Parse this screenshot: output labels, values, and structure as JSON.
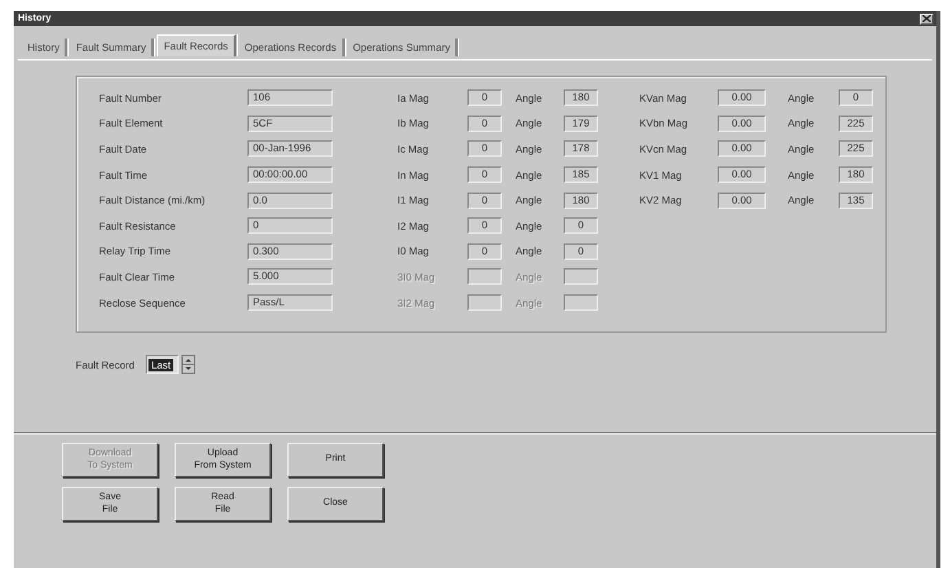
{
  "window": {
    "title": "History"
  },
  "tabs": [
    {
      "label": "History",
      "selected": false
    },
    {
      "label": "Fault Summary",
      "selected": false
    },
    {
      "label": "Fault Records",
      "selected": true
    },
    {
      "label": "Operations Records",
      "selected": false
    },
    {
      "label": "Operations Summary",
      "selected": false
    }
  ],
  "fault_info": [
    {
      "label": "Fault Number",
      "value": "106"
    },
    {
      "label": "Fault Element",
      "value": "5CF"
    },
    {
      "label": "Fault Date",
      "value": "00-Jan-1996"
    },
    {
      "label": "Fault Time",
      "value": "00:00:00.00"
    },
    {
      "label": "Fault Distance (mi./km)",
      "value": "0.0"
    },
    {
      "label": "Fault Resistance",
      "value": "0"
    },
    {
      "label": "Relay Trip Time",
      "value": "0.300"
    },
    {
      "label": "Fault Clear Time",
      "value": "5.000"
    },
    {
      "label": "Reclose Sequence",
      "value": "Pass/L"
    }
  ],
  "currents": [
    {
      "label": "Ia Mag",
      "mag": "0",
      "angle_label": "Angle",
      "angle": "180",
      "disabled": false
    },
    {
      "label": "Ib Mag",
      "mag": "0",
      "angle_label": "Angle",
      "angle": "179",
      "disabled": false
    },
    {
      "label": "Ic Mag",
      "mag": "0",
      "angle_label": "Angle",
      "angle": "178",
      "disabled": false
    },
    {
      "label": "In Mag",
      "mag": "0",
      "angle_label": "Angle",
      "angle": "185",
      "disabled": false
    },
    {
      "label": "I1 Mag",
      "mag": "0",
      "angle_label": "Angle",
      "angle": "180",
      "disabled": false
    },
    {
      "label": "I2 Mag",
      "mag": "0",
      "angle_label": "Angle",
      "angle": "0",
      "disabled": false
    },
    {
      "label": "I0 Mag",
      "mag": "0",
      "angle_label": "Angle",
      "angle": "0",
      "disabled": false
    },
    {
      "label": "3I0 Mag",
      "angle_label": "Angle",
      "disabled": true
    },
    {
      "label": "3I2 Mag",
      "angle_label": "Angle",
      "disabled": true
    }
  ],
  "voltages": [
    {
      "label": "KVan Mag",
      "mag": "0.00",
      "angle_label": "Angle",
      "angle": "0"
    },
    {
      "label": "KVbn Mag",
      "mag": "0.00",
      "angle_label": "Angle",
      "angle": "225"
    },
    {
      "label": "KVcn Mag",
      "mag": "0.00",
      "angle_label": "Angle",
      "angle": "225"
    },
    {
      "label": "KV1 Mag",
      "mag": "0.00",
      "angle_label": "Angle",
      "angle": "180"
    },
    {
      "label": "KV2 Mag",
      "mag": "0.00",
      "angle_label": "Angle",
      "angle": "135"
    }
  ],
  "fault_record": {
    "label": "Fault Record",
    "value": "Last"
  },
  "buttons": [
    {
      "lines": [
        "Download",
        "To System"
      ],
      "disabled": true
    },
    {
      "lines": [
        "Upload",
        "From System"
      ],
      "disabled": false
    },
    {
      "lines": [
        "Print"
      ],
      "disabled": false
    },
    {
      "lines": [
        "Save",
        "File"
      ],
      "disabled": false
    },
    {
      "lines": [
        "Read",
        "File"
      ],
      "disabled": false
    },
    {
      "lines": [
        "Close"
      ],
      "disabled": false
    }
  ]
}
